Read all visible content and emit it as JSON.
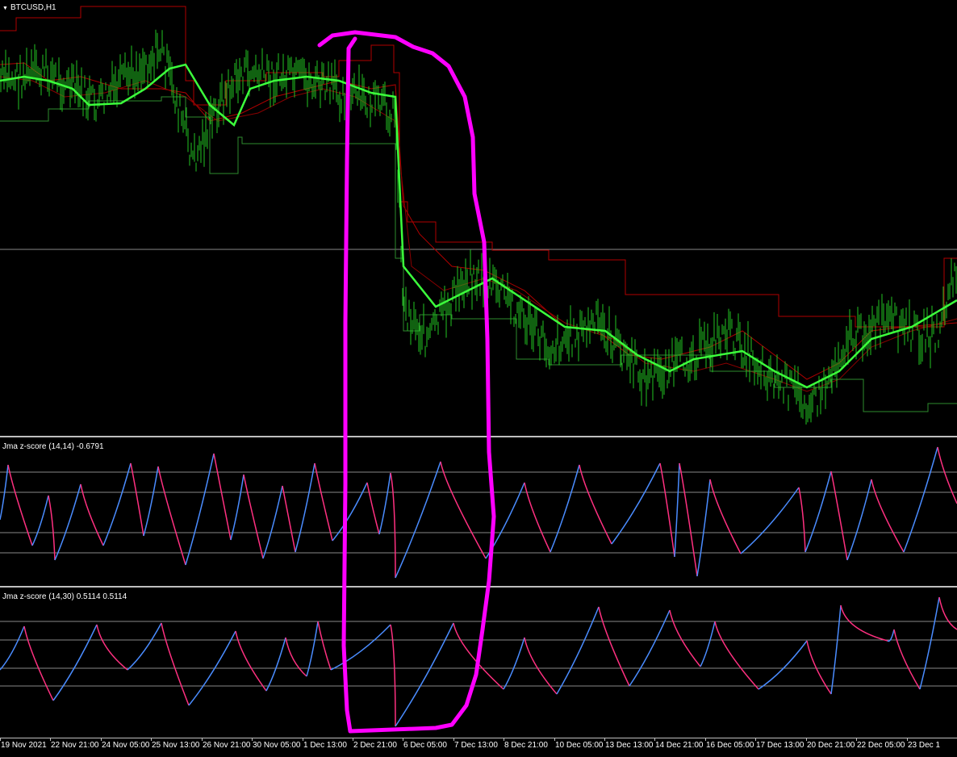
{
  "window": {
    "symbol_label": "BTCUSD,H1"
  },
  "indicators": [
    {
      "label": "Jma z-score (14,14) -0.6791"
    },
    {
      "label": "Jma z-score (14,30) 0.5114 0.5114"
    }
  ],
  "time_axis": {
    "labels": [
      "19 Nov 2021",
      "22 Nov 21:00",
      "24 Nov 05:00",
      "25 Nov 13:00",
      "26 Nov 21:00",
      "30 Nov 05:00",
      "1 Dec 13:00",
      "2 Dec 21:00",
      "6 Dec 05:00",
      "7 Dec 13:00",
      "8 Dec 21:00",
      "10 Dec 05:00",
      "13 Dec 13:00",
      "14 Dec 21:00",
      "16 Dec 05:00",
      "17 Dec 13:00",
      "20 Dec 21:00",
      "22 Dec 05:00",
      "23 Dec 1"
    ]
  },
  "colors": {
    "background": "#000000",
    "price_bars": "#22c322",
    "jma_line": "#3cff3c",
    "channel_red": "#b00000",
    "channel_green": "#2e8b2e",
    "osc_up": "#4a8cff",
    "osc_down": "#ff3080",
    "annotation": "#ff00ff",
    "grid": "#888888"
  },
  "icons": {
    "menu": "triangle-down-icon"
  }
}
